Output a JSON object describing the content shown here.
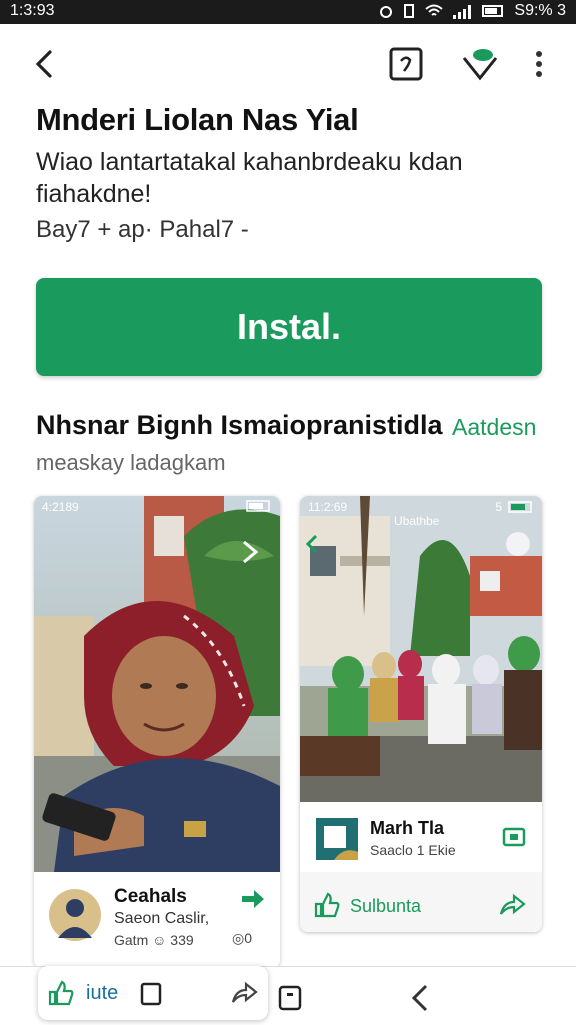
{
  "status": {
    "time": "1:3:93",
    "right_text": "S9:% 3"
  },
  "app": {
    "title": "Mnderi Liolan Nas Yial",
    "description": "Wiao lantartatakal kahanbrdeaku kdan fiahakdne!",
    "meta": "Bay7 + ap· Pahal7 -",
    "install_label": "Instal."
  },
  "section": {
    "title": "Nhsnar Bignh Ismaiopranistidla",
    "link": "Aatdesn",
    "subtitle": "measkay ladagkam"
  },
  "cards": [
    {
      "mini_time": "4:2189",
      "title": "Ceahals",
      "subtitle": "Saeon Caslir,",
      "meta": "Gatm ☺ 339",
      "meta_right": "◎0"
    },
    {
      "mini_time": "11:2:69",
      "mini_right": "5",
      "image_text": "Ubathbe",
      "title": "Marh Tla",
      "subtitle": "Saaclo 1 Ekie",
      "action_label": "Sulbunta"
    }
  ],
  "bottom": {
    "pill_label": "iute"
  },
  "colors": {
    "accent": "#1a9a5c",
    "statusbar": "#1b1b1b"
  },
  "icons": [
    "back-icon",
    "tag-icon",
    "diamond-icon",
    "more-vert-icon",
    "thumb-up-icon",
    "share-icon",
    "square-icon",
    "chevron-left-icon"
  ]
}
